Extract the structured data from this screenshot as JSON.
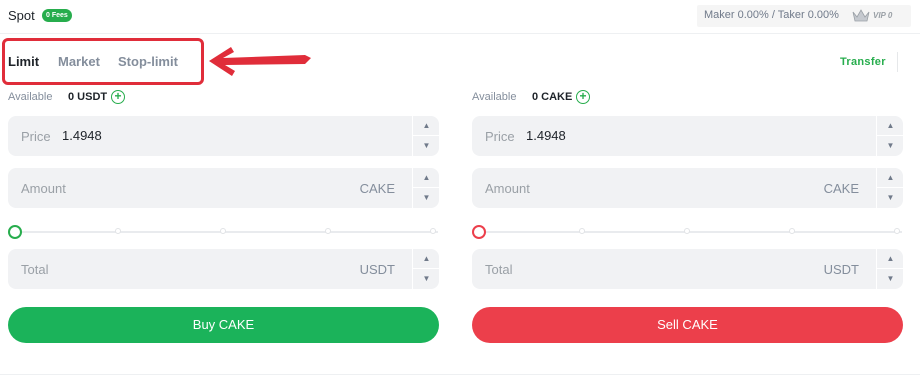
{
  "header": {
    "title": "Spot",
    "fee_badge": "0 Fees",
    "fees_text": "Maker 0.00% / Taker 0.00%",
    "vip_label": "VIP 0"
  },
  "tabs": [
    {
      "label": "Limit",
      "active": true
    },
    {
      "label": "Market",
      "active": false
    },
    {
      "label": "Stop-limit",
      "active": false
    }
  ],
  "transfer_label": "Transfer",
  "buy": {
    "available_label": "Available",
    "available_value": "0 USDT",
    "price_label": "Price",
    "price_value": "1.4948",
    "amount_label": "Amount",
    "amount_unit": "CAKE",
    "total_label": "Total",
    "total_unit": "USDT",
    "slider_fraction": 0,
    "button_label": "Buy CAKE"
  },
  "sell": {
    "available_label": "Available",
    "available_value": "0 CAKE",
    "price_label": "Price",
    "price_value": "1.4948",
    "amount_label": "Amount",
    "amount_unit": "CAKE",
    "total_label": "Total",
    "total_unit": "USDT",
    "slider_fraction": 0,
    "button_label": "Sell CAKE"
  },
  "colors": {
    "buy": "#1bb35a",
    "sell": "#ec3f4b",
    "accent": "#27ad4d",
    "highlight": "#e02d3a"
  },
  "icons": {
    "stepper_up": "▲",
    "stepper_down": "▼",
    "add": "+"
  }
}
